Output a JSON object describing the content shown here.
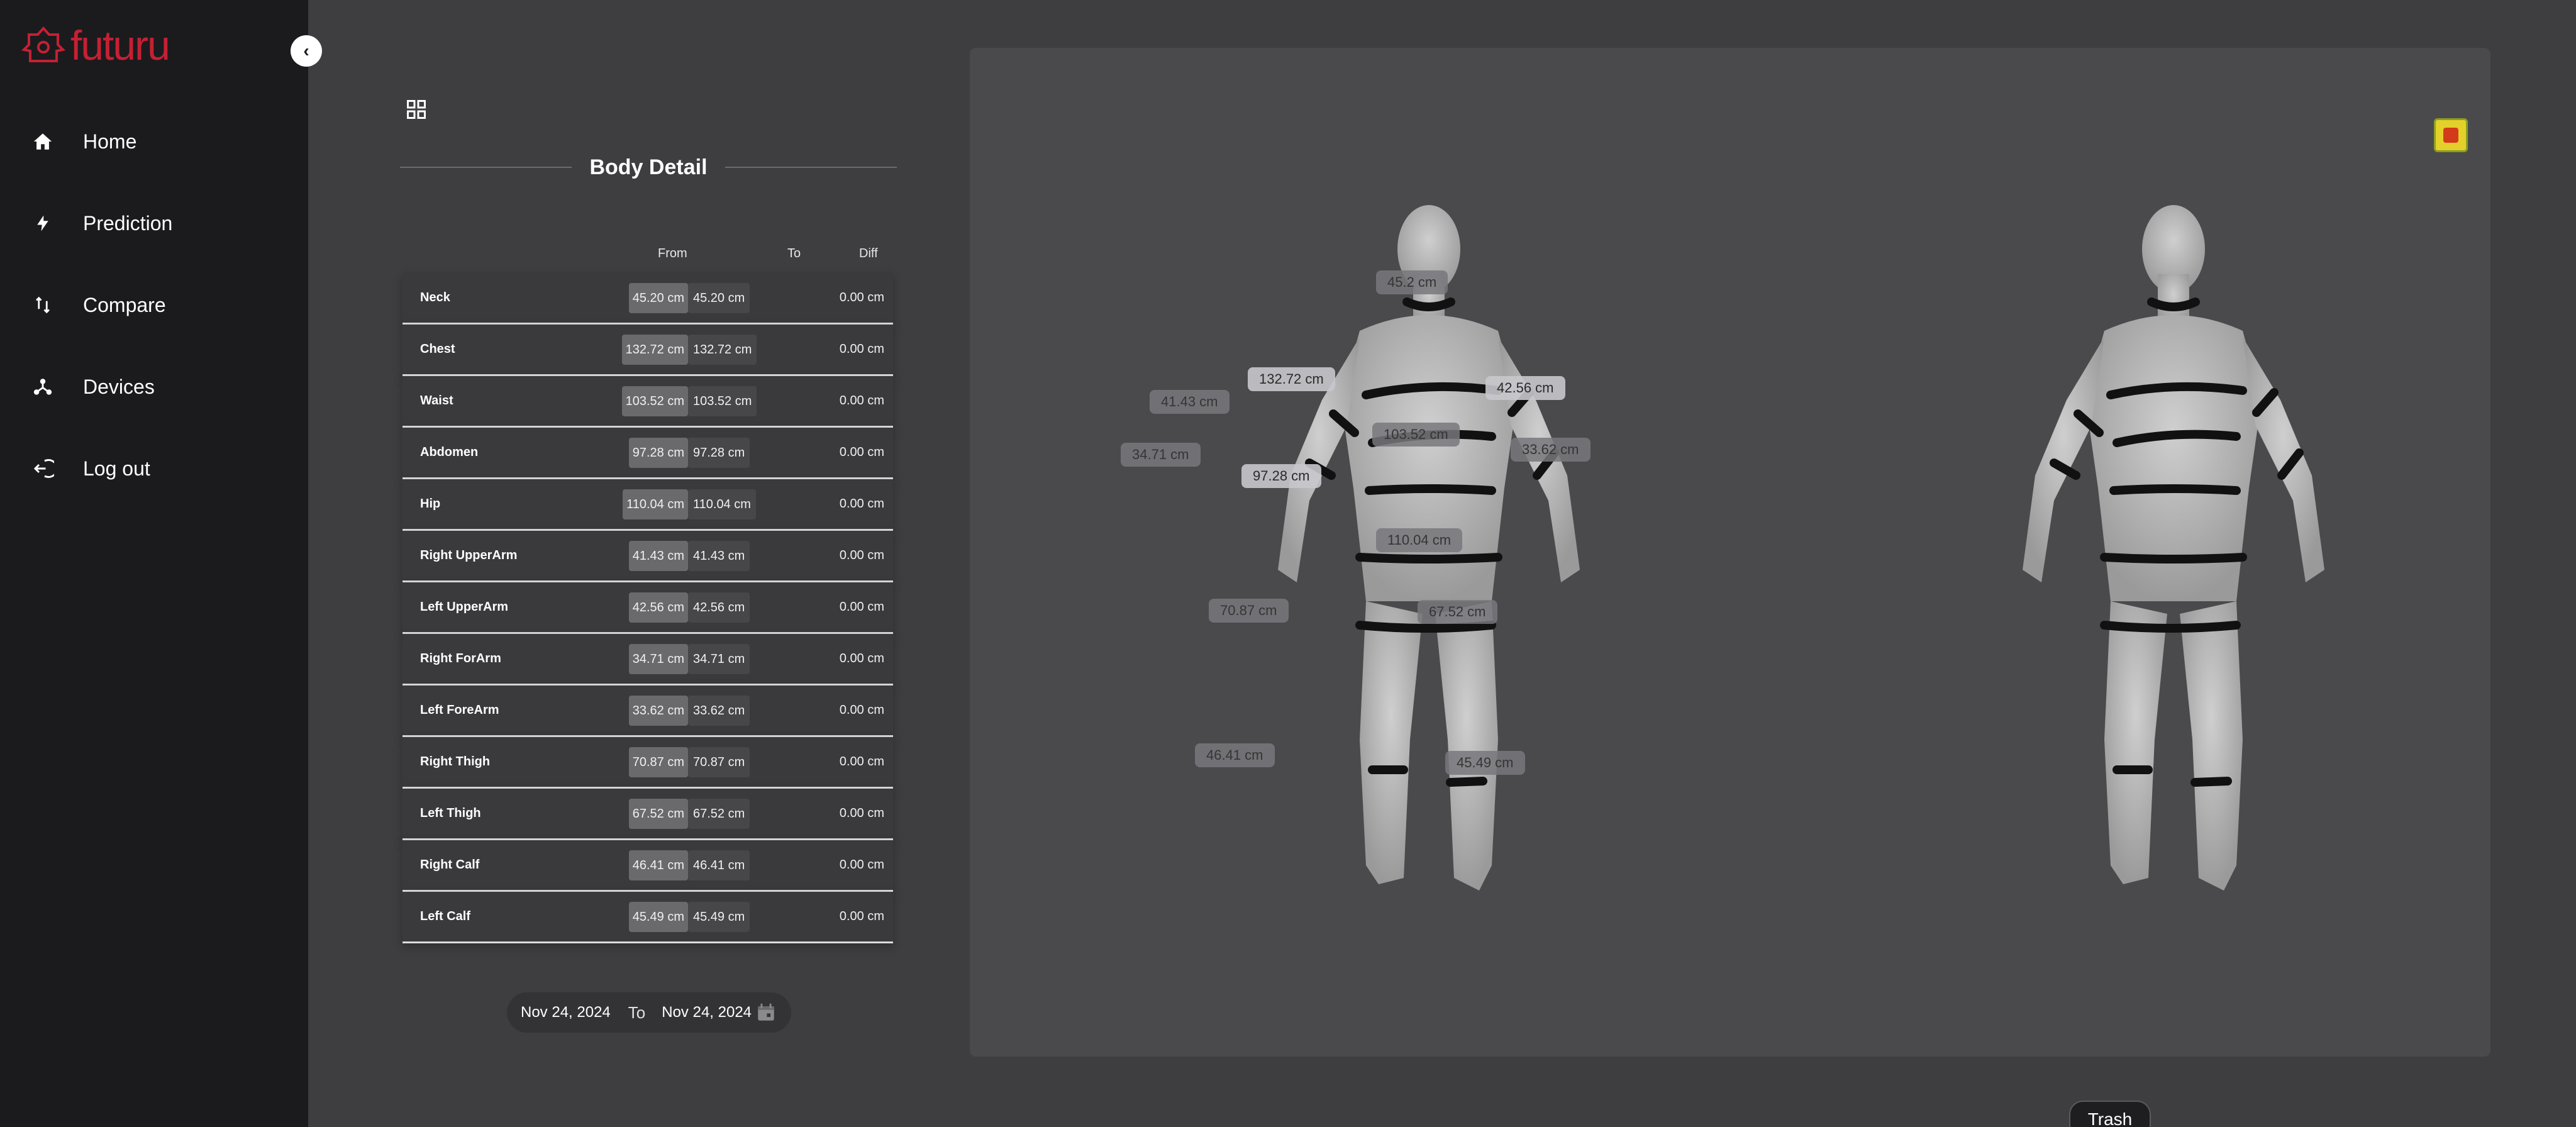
{
  "app": {
    "logo_text": "futuru",
    "collapse_icon": "chevron-left-icon"
  },
  "nav": [
    {
      "label": "Home",
      "icon": "home-icon"
    },
    {
      "label": "Prediction",
      "icon": "lightning-icon"
    },
    {
      "label": "Compare",
      "icon": "swap-vertical-icon"
    },
    {
      "label": "Devices",
      "icon": "hub-icon"
    },
    {
      "label": "Log out",
      "icon": "logout-icon"
    }
  ],
  "panel": {
    "title": "Body Detail",
    "headers": {
      "from": "From",
      "to": "To",
      "diff": "Diff"
    },
    "rows": [
      {
        "name": "Neck",
        "from": "45.20 cm",
        "to": "45.20 cm",
        "diff": "0.00 cm"
      },
      {
        "name": "Chest",
        "from": "132.72 cm",
        "to": "132.72 cm",
        "diff": "0.00 cm"
      },
      {
        "name": "Waist",
        "from": "103.52 cm",
        "to": "103.52 cm",
        "diff": "0.00 cm"
      },
      {
        "name": "Abdomen",
        "from": "97.28 cm",
        "to": "97.28 cm",
        "diff": "0.00 cm"
      },
      {
        "name": "Hip",
        "from": "110.04 cm",
        "to": "110.04 cm",
        "diff": "0.00 cm"
      },
      {
        "name": "Right UpperArm",
        "from": "41.43 cm",
        "to": "41.43 cm",
        "diff": "0.00 cm"
      },
      {
        "name": "Left UpperArm",
        "from": "42.56 cm",
        "to": "42.56 cm",
        "diff": "0.00 cm"
      },
      {
        "name": "Right ForArm",
        "from": "34.71 cm",
        "to": "34.71 cm",
        "diff": "0.00 cm"
      },
      {
        "name": "Left ForeArm",
        "from": "33.62 cm",
        "to": "33.62 cm",
        "diff": "0.00 cm"
      },
      {
        "name": "Right Thigh",
        "from": "70.87 cm",
        "to": "70.87 cm",
        "diff": "0.00 cm"
      },
      {
        "name": "Left Thigh",
        "from": "67.52 cm",
        "to": "67.52 cm",
        "diff": "0.00 cm"
      },
      {
        "name": "Right Calf",
        "from": "46.41 cm",
        "to": "46.41 cm",
        "diff": "0.00 cm"
      },
      {
        "name": "Left Calf",
        "from": "45.49 cm",
        "to": "45.49 cm",
        "diff": "0.00 cm"
      }
    ]
  },
  "date_range": {
    "start": "Nov 24, 2024",
    "separator": "To",
    "end": "Nov 24, 2024"
  },
  "model_tags": {
    "neck": "45.2 cm",
    "chest": "132.72 cm",
    "left_upperarm": "42.56 cm",
    "right_upperarm": "41.43 cm",
    "waist": "103.52 cm",
    "left_forearm": "33.62 cm",
    "right_forearm": "34.71 cm",
    "abdomen": "97.28 cm",
    "hip": "110.04 cm",
    "right_thigh": "70.87 cm",
    "left_thigh": "67.52 cm",
    "right_calf": "46.41 cm",
    "left_calf": "45.49 cm"
  },
  "actions": {
    "trash": "Trash"
  },
  "colors": {
    "brand": "#c42034",
    "sidebar_bg": "#1b1b1d",
    "main_bg": "#3e3e41",
    "viewer_bg": "#4a4a4d"
  }
}
